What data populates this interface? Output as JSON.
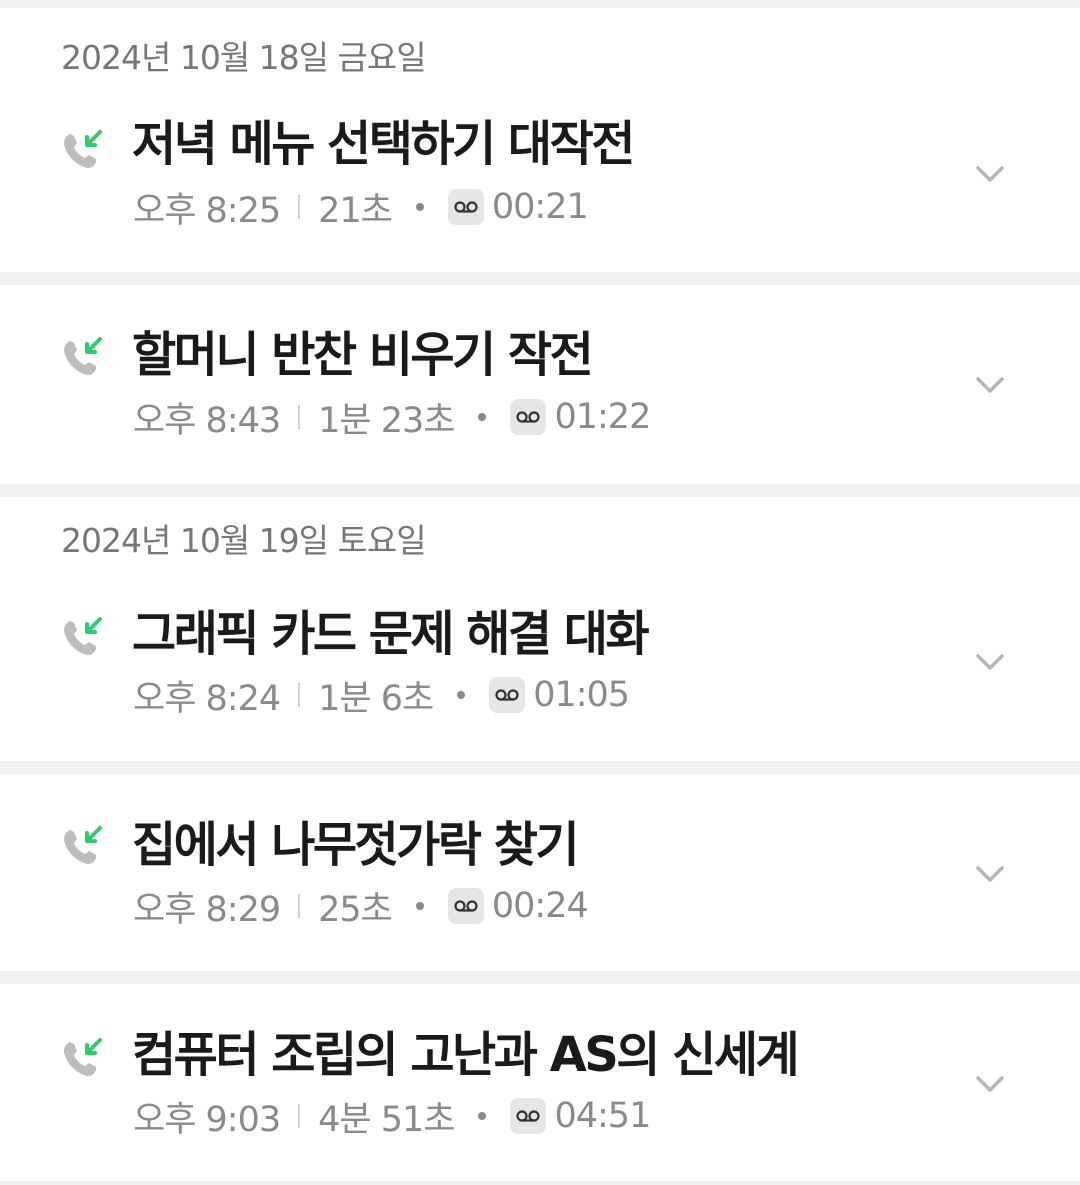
{
  "groups": [
    {
      "date": "2024년 10월 18일 금요일",
      "calls": [
        {
          "title": "저녁 메뉴 선택하기 대작전",
          "time": "오후 8:25",
          "duration": "21초",
          "recording": "00:21"
        },
        {
          "title": "할머니 반찬 비우기 작전",
          "time": "오후 8:43",
          "duration": "1분 23초",
          "recording": "01:22"
        }
      ]
    },
    {
      "date": "2024년 10월 19일 토요일",
      "calls": [
        {
          "title": "그래픽 카드 문제 해결 대화",
          "time": "오후 8:24",
          "duration": "1분 6초",
          "recording": "01:05"
        },
        {
          "title": "집에서 나무젓가락 찾기",
          "time": "오후 8:29",
          "duration": "25초",
          "recording": "00:24"
        },
        {
          "title": "컴퓨터 조립의 고난과 AS의 신세계",
          "time": "오후 9:03",
          "duration": "4분 51초",
          "recording": "04:51"
        }
      ]
    }
  ],
  "icons": {
    "call": "incoming-call-icon",
    "recording": "voicemail-icon",
    "expand": "chevron-down-icon"
  },
  "colors": {
    "incoming_arrow": "#2ecc71",
    "phone_handset": "#bdbdbd",
    "separator": "#f2f2f2"
  }
}
